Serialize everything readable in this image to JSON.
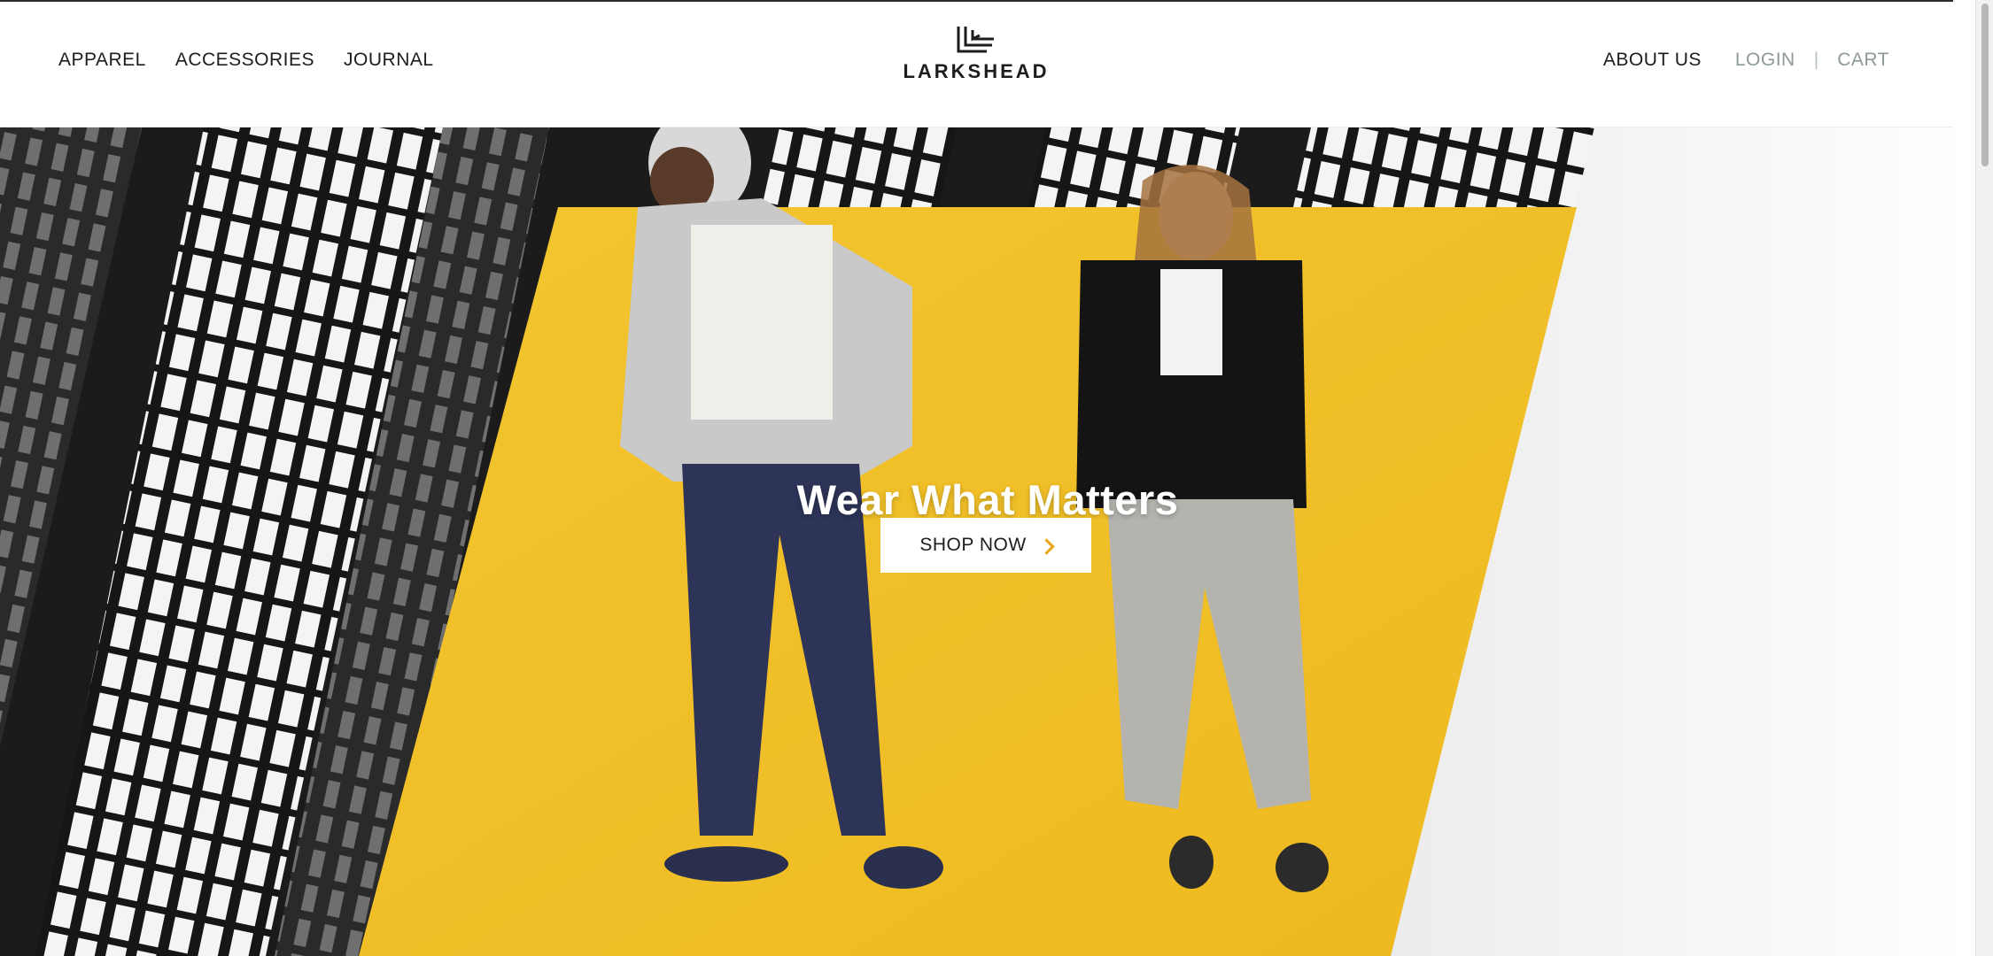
{
  "nav": {
    "left": [
      "APPAREL",
      "ACCESSORIES",
      "JOURNAL"
    ],
    "right": {
      "about": "ABOUT US",
      "login": "LOGIN",
      "separator": "|",
      "cart": "CART"
    }
  },
  "brand": {
    "name": "LARKSHEAD",
    "icon": "larkshead-logo-icon"
  },
  "hero": {
    "title": "Wear What Matters",
    "cta_label": "SHOP NOW",
    "cta_icon": "chevron-right-icon",
    "accent_color": "#f2c230",
    "chevron_color": "#e8a516"
  }
}
